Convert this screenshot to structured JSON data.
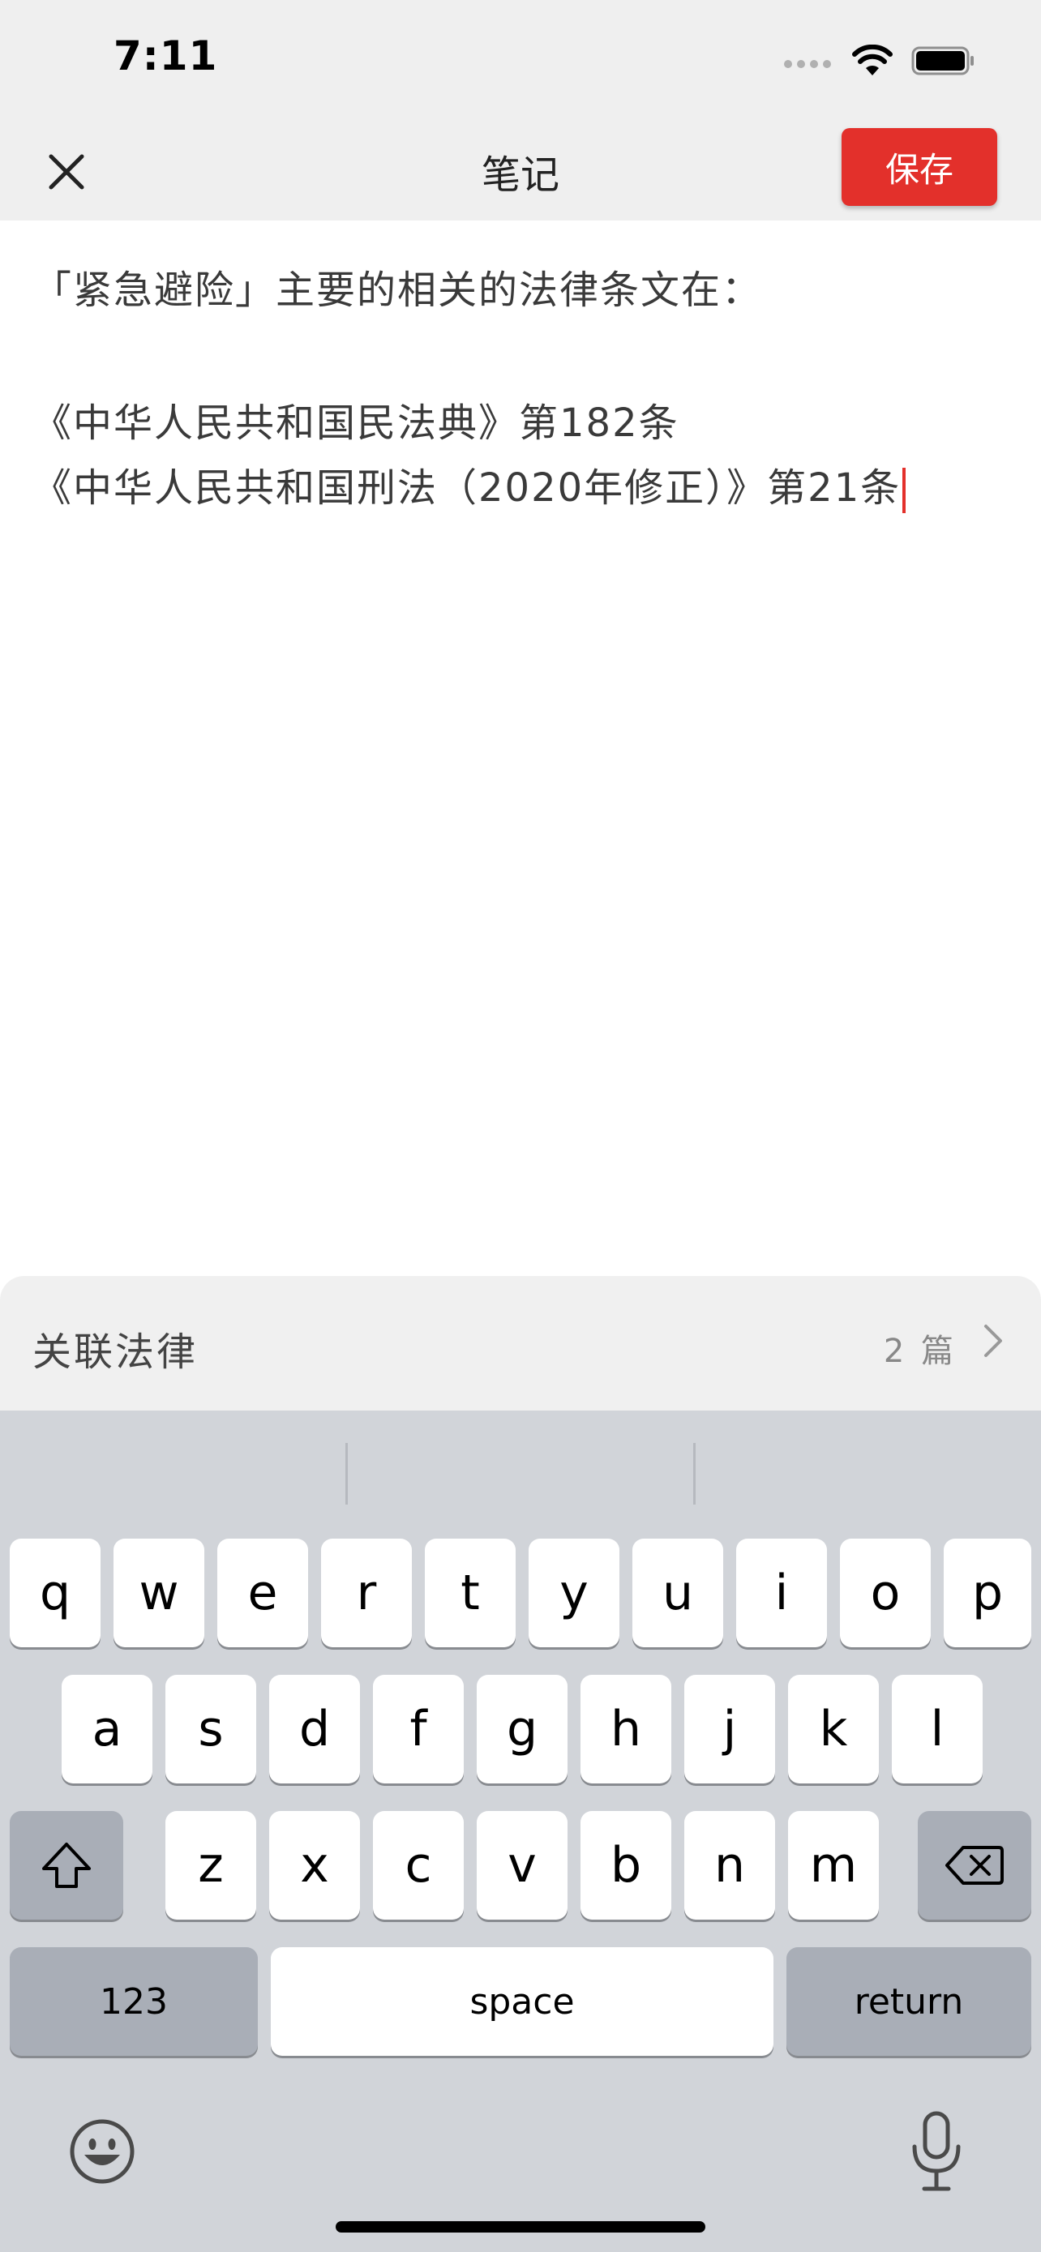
{
  "status": {
    "time": "7:11",
    "icons": [
      "signal-icon",
      "wifi-icon",
      "battery-icon"
    ]
  },
  "nav": {
    "title": "笔记",
    "save_label": "保存",
    "close_icon": "close-icon"
  },
  "note": {
    "lines": [
      "「紧急避险」主要的相关的法律条文在：",
      "",
      "《中华人民共和国民法典》第182条",
      "《中华人民共和国刑法（2020年修正）》第21条"
    ]
  },
  "related": {
    "label": "关联法律",
    "count": "2 篇"
  },
  "keyboard": {
    "row1": [
      "q",
      "w",
      "e",
      "r",
      "t",
      "y",
      "u",
      "i",
      "o",
      "p"
    ],
    "row2": [
      "a",
      "s",
      "d",
      "f",
      "g",
      "h",
      "j",
      "k",
      "l"
    ],
    "row3": [
      "z",
      "x",
      "c",
      "v",
      "b",
      "n",
      "m"
    ],
    "numbers_label": "123",
    "space_label": "space",
    "return_label": "return"
  },
  "colors": {
    "accent": "#e3302b",
    "nav_background": "#efefef",
    "keyboard_background": "#d1d4d9"
  }
}
